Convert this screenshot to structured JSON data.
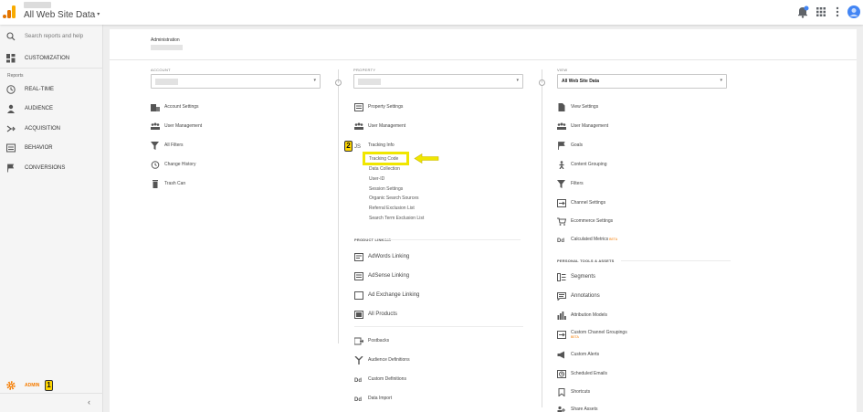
{
  "header": {
    "property_title": "All Web Site Data",
    "caret": "▾"
  },
  "sidebar": {
    "search_placeholder": "Search reports and help",
    "customization": "CUSTOMIZATION",
    "reports_label": "Reports",
    "items": [
      {
        "label": "REAL-TIME",
        "icon": "clock-icon"
      },
      {
        "label": "AUDIENCE",
        "icon": "person-icon"
      },
      {
        "label": "ACQUISITION",
        "icon": "acquisition-icon"
      },
      {
        "label": "BEHAVIOR",
        "icon": "behavior-icon"
      },
      {
        "label": "CONVERSIONS",
        "icon": "flag-icon"
      }
    ],
    "admin": "ADMIN",
    "collapse": "‹"
  },
  "main": {
    "breadcrumb": "Administration",
    "account": {
      "heading": "ACCOUNT",
      "items": [
        "Account Settings",
        "User Management",
        "All Filters",
        "Change History",
        "Trash Can"
      ]
    },
    "property": {
      "heading": "PROPERTY",
      "items": [
        "Property Settings",
        "User Management",
        "Tracking Info"
      ],
      "tracking_sub": [
        "Tracking Code",
        "Data Collection",
        "User-ID",
        "Session Settings",
        "Organic Search Sources",
        "Referral Exclusion List",
        "Search Term Exclusion List"
      ],
      "product_linking_label": "PRODUCT LINKING",
      "linking": [
        "AdWords Linking",
        "AdSense Linking",
        "Ad Exchange Linking",
        "All Products"
      ],
      "more": [
        "Postbacks",
        "Audience Definitions",
        "Custom Definitions",
        "Data Import"
      ]
    },
    "view": {
      "heading": "VIEW",
      "selected": "All Web Site Data",
      "items": [
        "View Settings",
        "User Management",
        "Goals",
        "Content Grouping",
        "Filters",
        "Channel Settings",
        "Ecommerce Settings",
        "Calculated Metrics"
      ],
      "beta": "BETA",
      "personal_label": "PERSONAL TOOLS & ASSETS",
      "personal": [
        "Segments",
        "Annotations",
        "Attribution Models",
        "Custom Channel Groupings",
        "Custom Alerts",
        "Scheduled Emails",
        "Shortcuts",
        "Share Assets"
      ]
    }
  },
  "annotations": {
    "badge_1": "1",
    "badge_2": "2"
  },
  "colors": {
    "accent": "#f57c00",
    "highlight": "#f0e600",
    "avatar": "#4285f4"
  }
}
